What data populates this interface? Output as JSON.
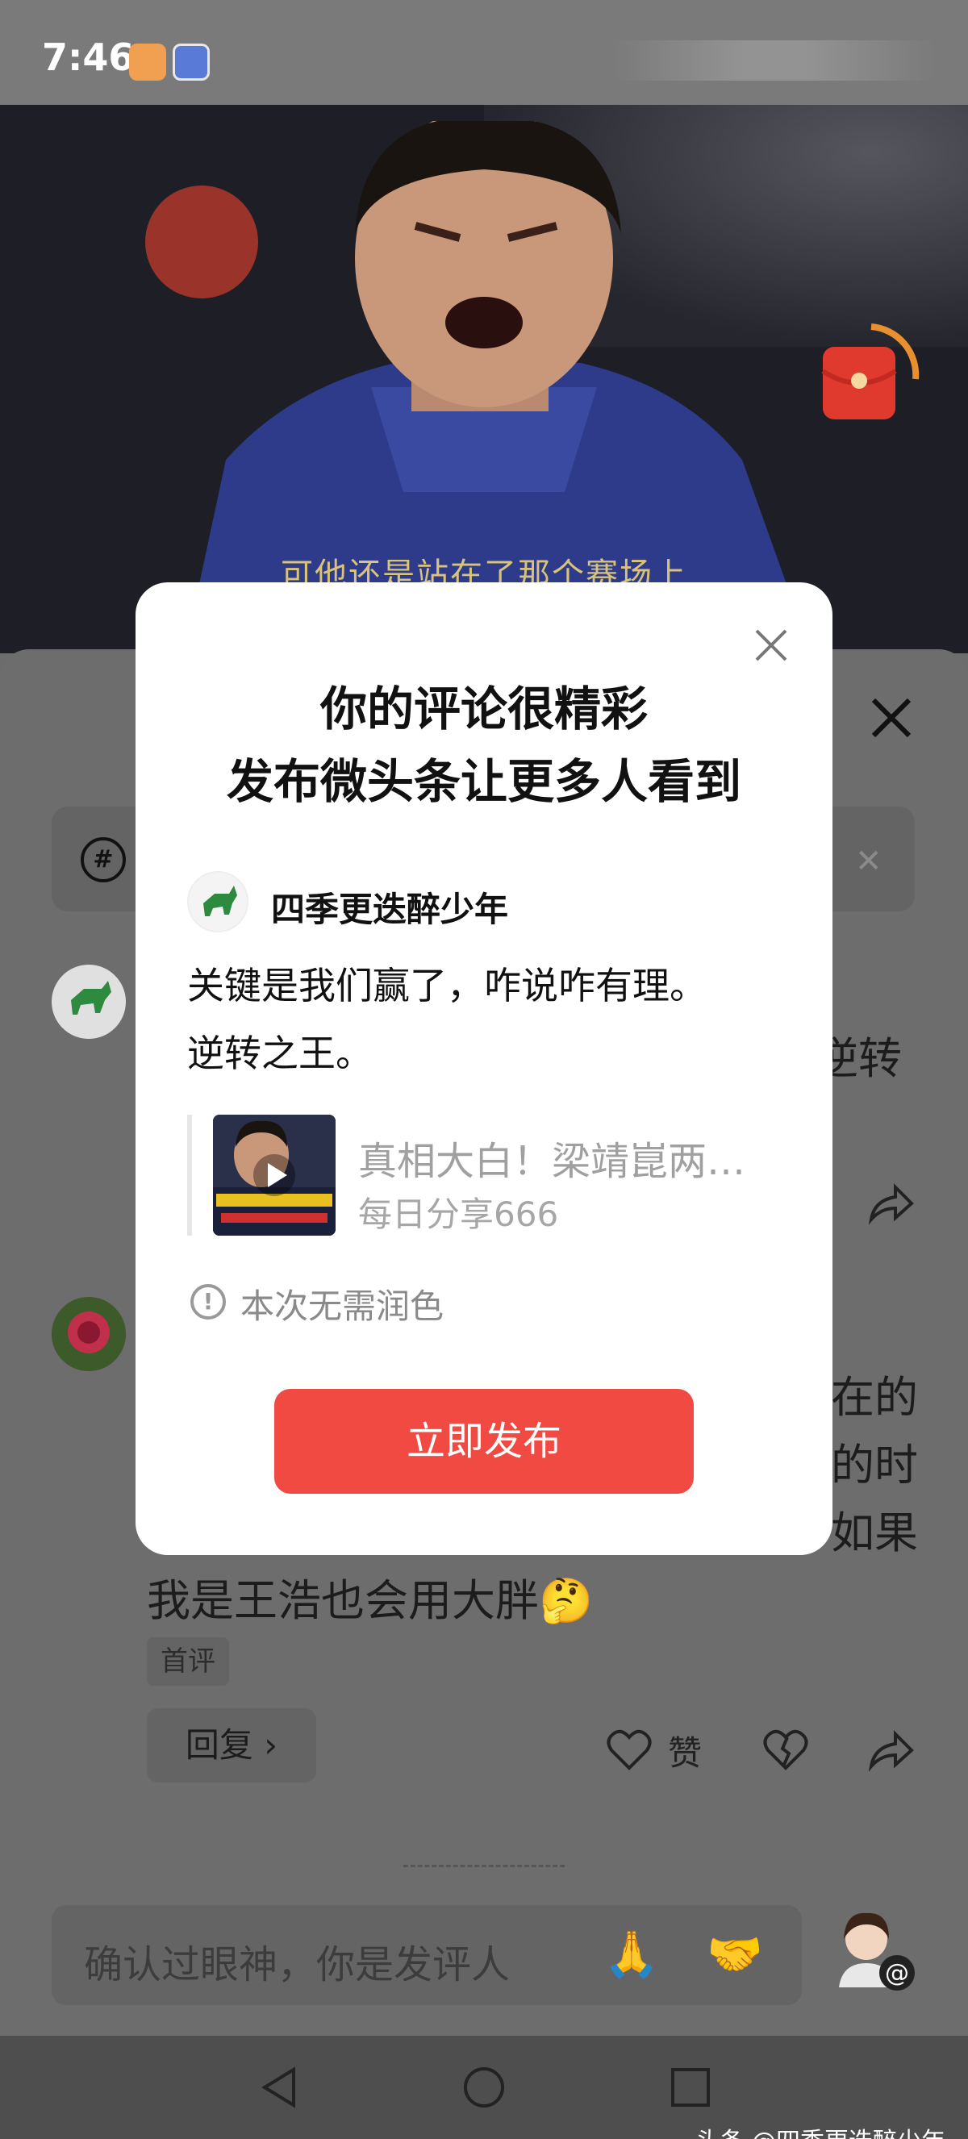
{
  "status_bar": {
    "time": "7:46"
  },
  "video": {
    "subtitle": "可他还是站在了那个赛场上"
  },
  "background": {
    "comment1_tail": "逆转",
    "comment2_lines": [
      "在的",
      "的时",
      "如果"
    ],
    "comment2_last": "我是王浩也会用大胖🤔",
    "first_badge": "首评",
    "reply_label": "回复 ›",
    "like_label": "赞",
    "topic_icon": "#",
    "topic_close": "✕",
    "input_placeholder": "确认过眼神，你是发评人",
    "emoji1": "🙏",
    "emoji2": "🤝"
  },
  "dialog": {
    "title_line1": "你的评论很精彩",
    "title_line2": "发布微头条让更多人看到",
    "username": "四季更迭醉少年",
    "comment_line1": "关键是我们赢了，咋说咋有理。",
    "comment_line2": "逆转之王。",
    "quote_title": "真相大白！梁靖崑两…",
    "quote_source": "每日分享666",
    "notice_icon": "!",
    "notice": "本次无需润色",
    "publish_button": "立即发布"
  },
  "watermark": "头条 @四季更迭醉少年"
}
